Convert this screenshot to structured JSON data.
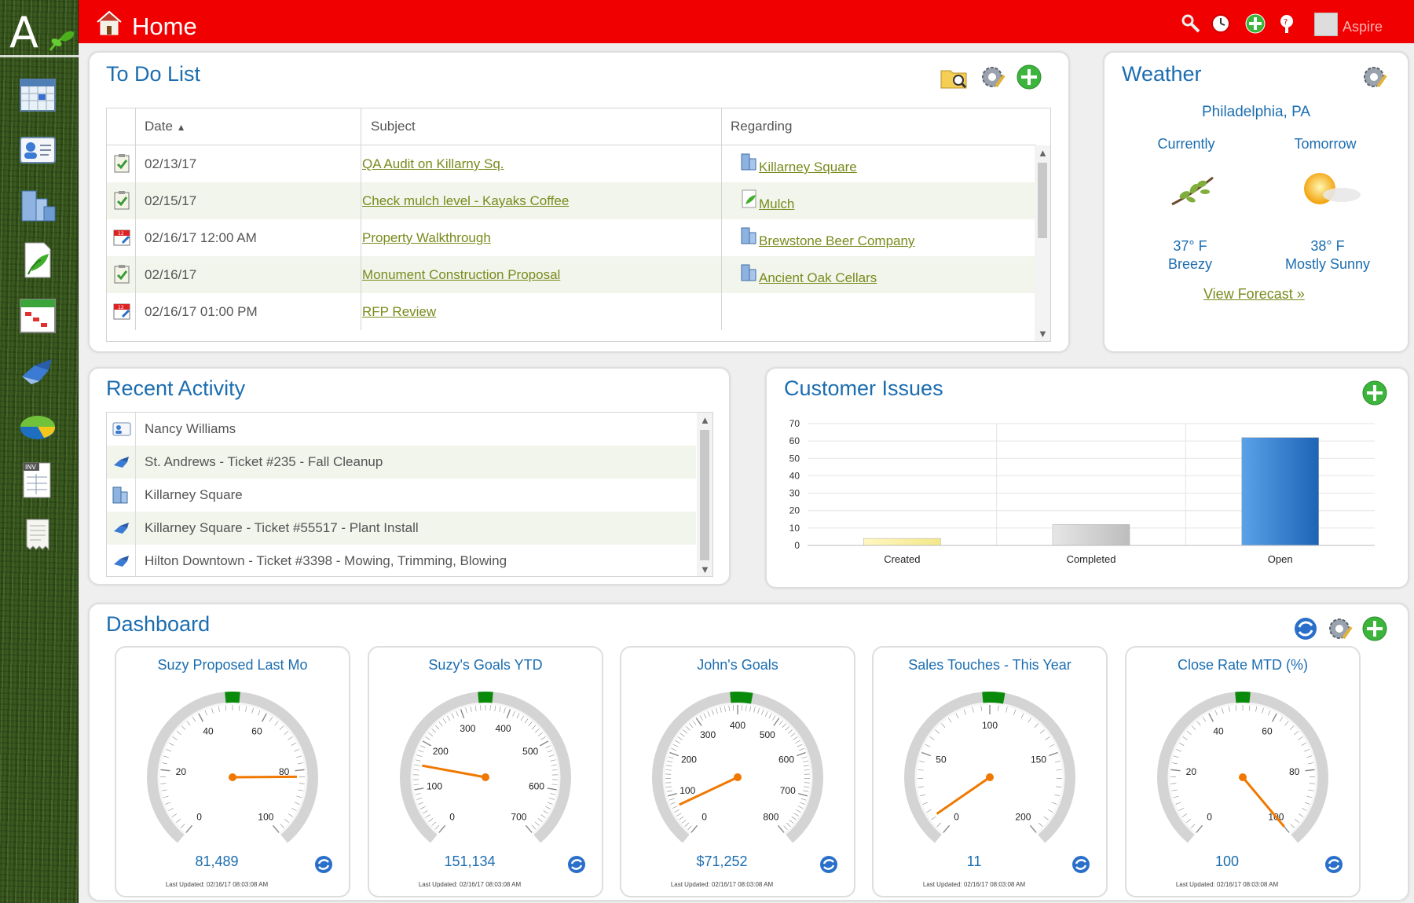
{
  "app": {
    "title": "Home",
    "user": "Aspire"
  },
  "sidebar": {
    "items": [
      "calendar-icon",
      "contacts-icon",
      "properties-icon",
      "catalog-icon",
      "schedule-icon",
      "tickets-icon",
      "reports-icon",
      "invoice-icon",
      "receipts-icon"
    ]
  },
  "todo": {
    "title": "To Do List",
    "columns": {
      "date": "Date",
      "subject": "Subject",
      "regarding": "Regarding"
    },
    "rows": [
      {
        "date": "02/13/17",
        "subject": "QA Audit on Killarny Sq.",
        "regarding": "Killarney Square",
        "type": "task"
      },
      {
        "date": "02/15/17",
        "subject": "Check mulch level - Kayaks Coffee",
        "regarding": "Mulch",
        "type": "task"
      },
      {
        "date": "02/16/17 12:00 AM",
        "subject": "Property Walkthrough",
        "regarding": "Brewstone Beer Company",
        "type": "appointment"
      },
      {
        "date": "02/16/17",
        "subject": "Monument Construction Proposal",
        "regarding": "Ancient Oak Cellars",
        "type": "task"
      },
      {
        "date": "02/16/17 01:00 PM",
        "subject": "RFP Review",
        "regarding": "",
        "type": "appointment"
      }
    ]
  },
  "weather": {
    "title": "Weather",
    "city": "Philadelphia, PA",
    "current": {
      "label": "Currently",
      "temp": "37° F",
      "desc": "Breezy"
    },
    "tomorrow": {
      "label": "Tomorrow",
      "temp": "38° F",
      "desc": "Mostly Sunny"
    },
    "link": "View Forecast »"
  },
  "activity": {
    "title": "Recent Activity",
    "items": [
      {
        "text": "Nancy Williams",
        "icon": "contact-icon"
      },
      {
        "text": "St. Andrews - Ticket #235 - Fall Cleanup",
        "icon": "ticket-icon"
      },
      {
        "text": "Killarney Square",
        "icon": "property-icon"
      },
      {
        "text": "Killarney Square - Ticket #55517 - Plant Install",
        "icon": "ticket-icon"
      },
      {
        "text": "Hilton Downtown - Ticket #3398 - Mowing, Trimming, Blowing",
        "icon": "ticket-icon"
      }
    ]
  },
  "issues": {
    "title": "Customer Issues"
  },
  "chart_data": {
    "type": "bar",
    "categories": [
      "Created",
      "Completed",
      "Open"
    ],
    "values": [
      4,
      12,
      62
    ],
    "ylim": [
      0,
      70
    ],
    "yticks": [
      0,
      10,
      20,
      30,
      40,
      50,
      60,
      70
    ],
    "colors": [
      "#fff3a0",
      "#cccccc",
      "#2f7fce"
    ],
    "grid": true
  },
  "dashboard": {
    "title": "Dashboard",
    "gauges": [
      {
        "title": "Suzy Proposed Last Mo",
        "value": "81,489",
        "min": 0,
        "max": 100,
        "pointer": 82,
        "ticks": [
          "0",
          "20",
          "40",
          "60",
          "80",
          "100"
        ],
        "updated": "Last Updated: 02/16/17 08:03:08 AM"
      },
      {
        "title": "Suzy's Goals YTD",
        "value": "151,134",
        "min": 0,
        "max": 700,
        "pointer": 151,
        "ticks": [
          "0",
          "100",
          "200",
          "300",
          "400",
          "500",
          "600",
          "700"
        ],
        "updated": "Last Updated: 02/16/17 08:03:08 AM"
      },
      {
        "title": "John's Goals",
        "value": "$71,252",
        "min": 0,
        "max": 800,
        "pointer": 71,
        "ticks": [
          "0",
          "100",
          "200",
          "300",
          "400",
          "500",
          "600",
          "700",
          "800"
        ],
        "updated": "Last Updated: 02/16/17 08:03:08 AM"
      },
      {
        "title": "Sales Touches - This Year",
        "value": "11",
        "min": 0,
        "max": 200,
        "pointer": 11,
        "ticks": [
          "0",
          "50",
          "100",
          "150",
          "200"
        ],
        "updated": "Last Updated: 02/16/17 08:03:08 AM"
      },
      {
        "title": "Close Rate MTD (%)",
        "value": "100",
        "min": 0,
        "max": 100,
        "pointer": 100,
        "ticks": [
          "0",
          "20",
          "40",
          "60",
          "80",
          "100"
        ],
        "updated": "Last Updated: 02/16/17 08:03:08 AM"
      }
    ]
  },
  "colors": {
    "brand_red": "#f00000",
    "title_blue": "#1b6db0",
    "link_olive": "#7a8a1c",
    "gauge_pointer": "#f07800",
    "gauge_target": "#0a8a0a"
  }
}
